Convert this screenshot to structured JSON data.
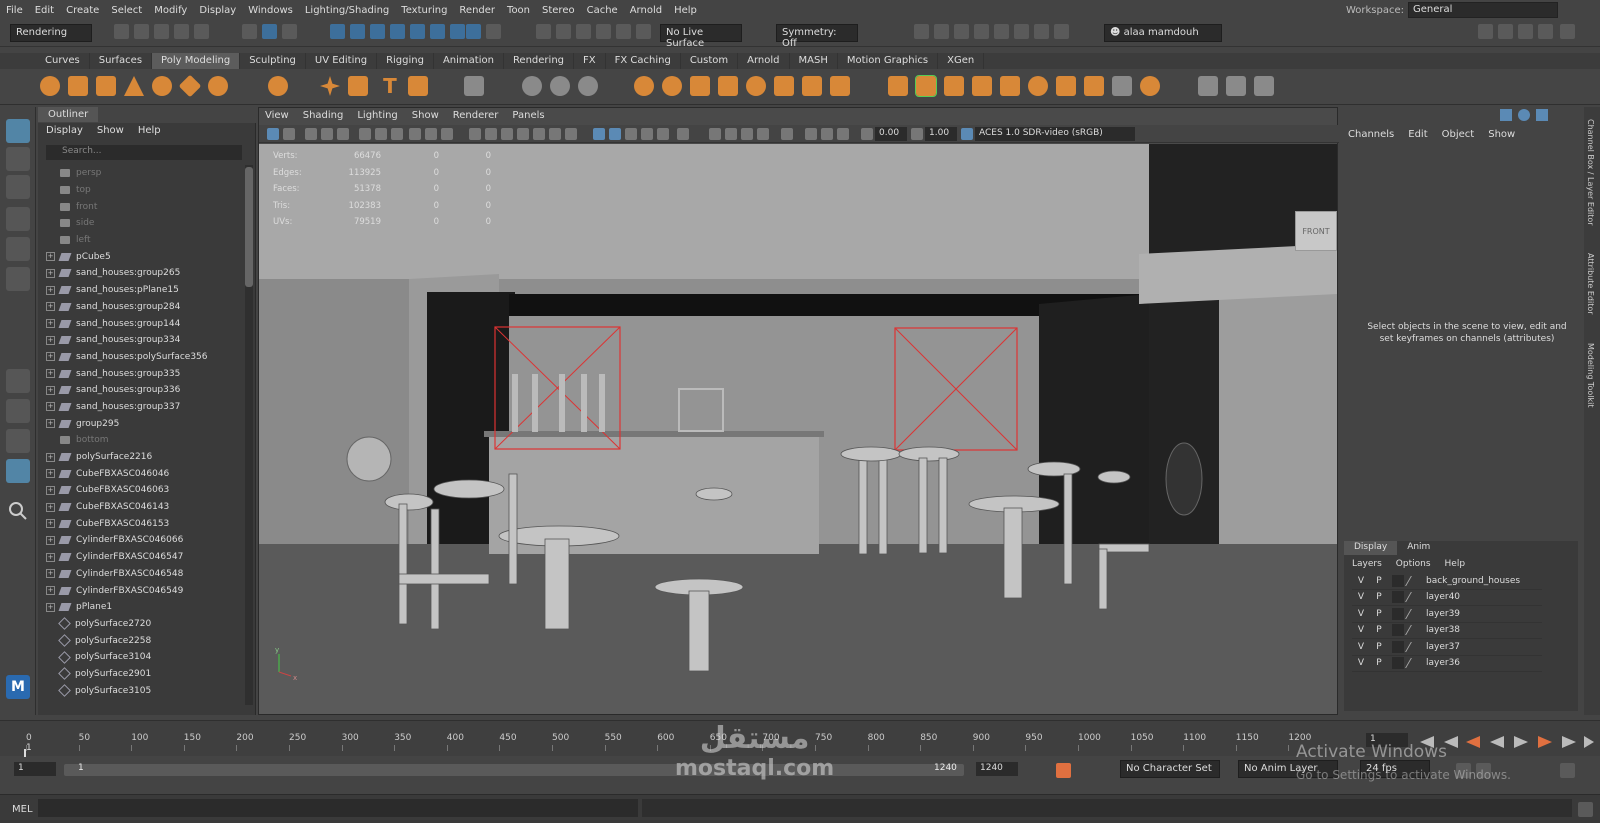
{
  "menubar": {
    "items": [
      "File",
      "Edit",
      "Create",
      "Select",
      "Modify",
      "Display",
      "Windows",
      "Lighting/Shading",
      "Texturing",
      "Render",
      "Toon",
      "Stereo",
      "Cache",
      "Arnold",
      "Help"
    ],
    "workspace_label": "Workspace:",
    "workspace_value": "General"
  },
  "status": {
    "menu_set": "Rendering",
    "live_surface": "No Live Surface",
    "symmetry": "Symmetry: Off",
    "user": "alaa mamdouh"
  },
  "shelf_tabs": {
    "items": [
      "Curves",
      "Surfaces",
      "Poly Modeling",
      "Sculpting",
      "UV Editing",
      "Rigging",
      "Animation",
      "Rendering",
      "FX",
      "FX Caching",
      "Custom",
      "Arnold",
      "MASH",
      "Motion Graphics",
      "XGen"
    ],
    "active": "Poly Modeling"
  },
  "outliner": {
    "title": "Outliner",
    "menu": [
      "Display",
      "Show",
      "Help"
    ],
    "search_placeholder": "Search...",
    "items": [
      {
        "label": "persp",
        "icon": "camera-icon",
        "dim": true,
        "expand": false
      },
      {
        "label": "top",
        "icon": "camera-icon",
        "dim": true,
        "expand": false
      },
      {
        "label": "front",
        "icon": "camera-icon",
        "dim": true,
        "expand": false
      },
      {
        "label": "side",
        "icon": "camera-icon",
        "dim": true,
        "expand": false
      },
      {
        "label": "left",
        "icon": "camera-icon",
        "dim": true,
        "expand": false
      },
      {
        "label": "pCube5",
        "icon": "group-icon",
        "dim": false,
        "expand": true
      },
      {
        "label": "sand_houses:group265",
        "icon": "group-icon",
        "dim": false,
        "expand": true
      },
      {
        "label": "sand_houses:pPlane15",
        "icon": "group-icon",
        "dim": false,
        "expand": true
      },
      {
        "label": "sand_houses:group284",
        "icon": "group-icon",
        "dim": false,
        "expand": true
      },
      {
        "label": "sand_houses:group144",
        "icon": "group-icon",
        "dim": false,
        "expand": true
      },
      {
        "label": "sand_houses:group334",
        "icon": "group-icon",
        "dim": false,
        "expand": true
      },
      {
        "label": "sand_houses:polySurface356",
        "icon": "group-icon",
        "dim": false,
        "expand": true
      },
      {
        "label": "sand_houses:group335",
        "icon": "group-icon",
        "dim": false,
        "expand": true
      },
      {
        "label": "sand_houses:group336",
        "icon": "group-icon",
        "dim": false,
        "expand": true
      },
      {
        "label": "sand_houses:group337",
        "icon": "group-icon",
        "dim": false,
        "expand": true
      },
      {
        "label": "group295",
        "icon": "group-icon",
        "dim": false,
        "expand": true
      },
      {
        "label": "bottom",
        "icon": "camera-icon",
        "dim": true,
        "expand": false
      },
      {
        "label": "polySurface2216",
        "icon": "group-icon",
        "dim": false,
        "expand": true
      },
      {
        "label": "CubeFBXASC046046",
        "icon": "group-icon",
        "dim": false,
        "expand": true
      },
      {
        "label": "CubeFBXASC046063",
        "icon": "group-icon",
        "dim": false,
        "expand": true
      },
      {
        "label": "CubeFBXASC046143",
        "icon": "group-icon",
        "dim": false,
        "expand": true
      },
      {
        "label": "CubeFBXASC046153",
        "icon": "group-icon",
        "dim": false,
        "expand": true
      },
      {
        "label": "CylinderFBXASC046066",
        "icon": "group-icon",
        "dim": false,
        "expand": true
      },
      {
        "label": "CylinderFBXASC046547",
        "icon": "group-icon",
        "dim": false,
        "expand": true
      },
      {
        "label": "CylinderFBXASC046548",
        "icon": "group-icon",
        "dim": false,
        "expand": true
      },
      {
        "label": "CylinderFBXASC046549",
        "icon": "group-icon",
        "dim": false,
        "expand": true
      },
      {
        "label": "pPlane1",
        "icon": "group-icon",
        "dim": false,
        "expand": true
      },
      {
        "label": "polySurface2720",
        "icon": "mesh-icon",
        "dim": false,
        "expand": false
      },
      {
        "label": "polySurface2258",
        "icon": "mesh-icon",
        "dim": false,
        "expand": false
      },
      {
        "label": "polySurface3104",
        "icon": "mesh-icon",
        "dim": false,
        "expand": false
      },
      {
        "label": "polySurface2901",
        "icon": "mesh-icon",
        "dim": false,
        "expand": false
      },
      {
        "label": "polySurface3105",
        "icon": "mesh-icon",
        "dim": false,
        "expand": false
      }
    ]
  },
  "viewport": {
    "menu": [
      "View",
      "Shading",
      "Lighting",
      "Show",
      "Renderer",
      "Panels"
    ],
    "field_a": "0.00",
    "field_b": "1.00",
    "colorspace": "ACES 1.0 SDR-video (sRGB)",
    "hud": [
      {
        "k": "Verts:",
        "a": "66476",
        "b": "0",
        "c": "0"
      },
      {
        "k": "Edges:",
        "a": "113925",
        "b": "0",
        "c": "0"
      },
      {
        "k": "Faces:",
        "a": "51378",
        "b": "0",
        "c": "0"
      },
      {
        "k": "Tris:",
        "a": "102383",
        "b": "0",
        "c": "0"
      },
      {
        "k": "UVs:",
        "a": "79519",
        "b": "0",
        "c": "0"
      }
    ],
    "viewcube": "FRONT",
    "axis_x": "x",
    "axis_y": "y"
  },
  "channel_box": {
    "menu": [
      "Channels",
      "Edit",
      "Object",
      "Show"
    ],
    "message": "Select objects in the scene to view, edit and set keyframes on channels (attributes)",
    "side_tabs": [
      "Channel Box / Layer Editor",
      "Attribute Editor",
      "Modeling Toolkit"
    ]
  },
  "layers": {
    "tabs": [
      "Display",
      "Anim"
    ],
    "menu": [
      "Layers",
      "Options",
      "Help"
    ],
    "rows": [
      {
        "v": "V",
        "p": "P",
        "name": "back_ground_houses"
      },
      {
        "v": "V",
        "p": "P",
        "name": "layer40"
      },
      {
        "v": "V",
        "p": "P",
        "name": "layer39"
      },
      {
        "v": "V",
        "p": "P",
        "name": "layer38"
      },
      {
        "v": "V",
        "p": "P",
        "name": "layer37"
      },
      {
        "v": "V",
        "p": "P",
        "name": "layer36"
      }
    ]
  },
  "timeline": {
    "ticks": [
      "0",
      "50",
      "100",
      "150",
      "200",
      "250",
      "300",
      "350",
      "400",
      "450",
      "500",
      "550",
      "600",
      "650",
      "700",
      "750",
      "800",
      "850",
      "900",
      "950",
      "1000",
      "1050",
      "1100",
      "1150",
      "1200"
    ],
    "current_frame": "1"
  },
  "range": {
    "start": "1",
    "inner_start": "1",
    "inner_end": "1240",
    "end": "1240",
    "character_set": "No Character Set",
    "anim_layer": "No Anim Layer",
    "fps": "24 fps"
  },
  "cmdline": {
    "label": "MEL"
  },
  "overlay": {
    "watermark_ar": "مستقل",
    "watermark_en": "mostaql.com",
    "activate_title": "Activate Windows",
    "activate_sub": "Go to Settings to activate Windows."
  }
}
